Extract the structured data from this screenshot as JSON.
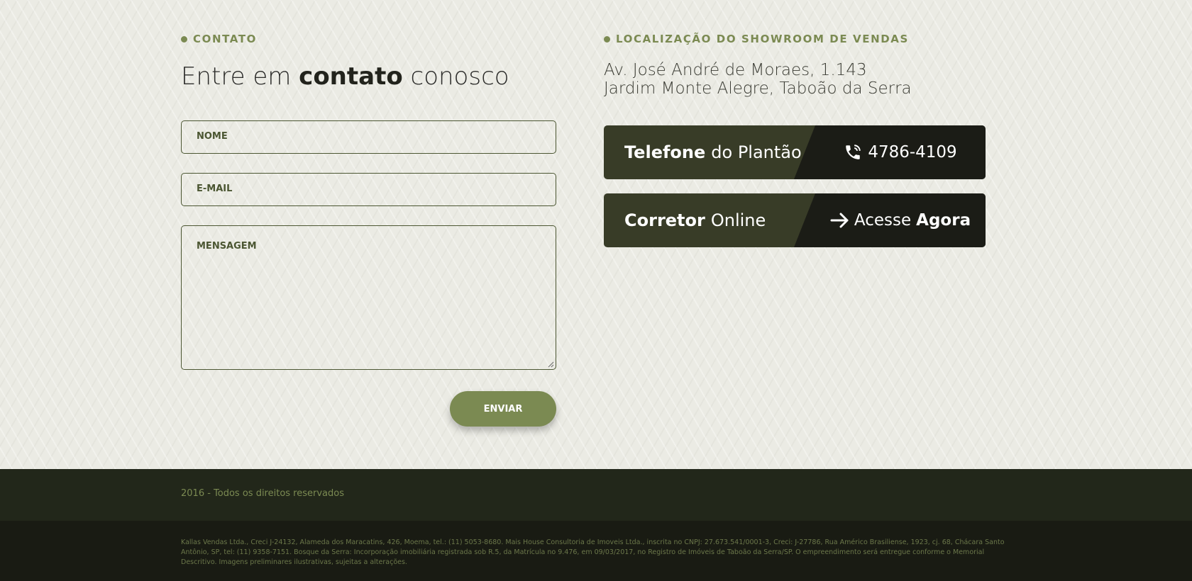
{
  "contact": {
    "section_label": "CONTATO",
    "heading_pre": "Entre em ",
    "heading_bold": "contato",
    "heading_post": " conosco",
    "name_placeholder": "NOME",
    "email_placeholder": "E-MAIL",
    "message_placeholder": "MENSAGEM",
    "send_label": "ENVIAR"
  },
  "location": {
    "section_label": "LOCALIZAÇÃO DO SHOWROOM DE VENDAS",
    "address_line1": "Av. José André de Moraes, 1.143",
    "address_line2": "Jardim Monte Alegre, Taboão da Serra"
  },
  "cards": {
    "phone": {
      "title_bold": "Telefone",
      "title_rest": "do Plantão",
      "icon": "phone-icon",
      "number": "4786-4109"
    },
    "broker": {
      "title_bold": "Corretor",
      "title_rest": "Online",
      "icon": "arrow-right-icon",
      "action_pre": "Acesse",
      "action_bold": "Agora"
    }
  },
  "footer": {
    "copyright": "2016 - Todos os direitos reservados",
    "legal": "Kallas Vendas Ltda., Creci J-24132, Alameda dos Maracatins, 426, Moema, tel.: (11) 5053-8680. Mais House Consultoria de Imoveis Ltda., inscrita no CNPJ: 27.673.541/0001-3, Creci: J-27786, Rua Américo Brasiliense, 1923, cj. 68, Chácara Santo Antônio, SP, tel: (11) 9358-7151. Bosque da Serra: Incorporação imobiliária registrada sob R.5, da Matrícula no 9.476, em 09/03/2017, no Registro de Imóveis de Taboão da Serra/SP. O empreendimento será entregue conforme o Memorial Descritivo. Imagens preliminares ilustrativas, sujeitas a alterações."
  },
  "colors": {
    "accent": "#7b8a52",
    "dark_card": "#383c27",
    "darker_card": "#1b1c16",
    "footer_top": "#22271a",
    "footer_bottom": "#191b13"
  }
}
